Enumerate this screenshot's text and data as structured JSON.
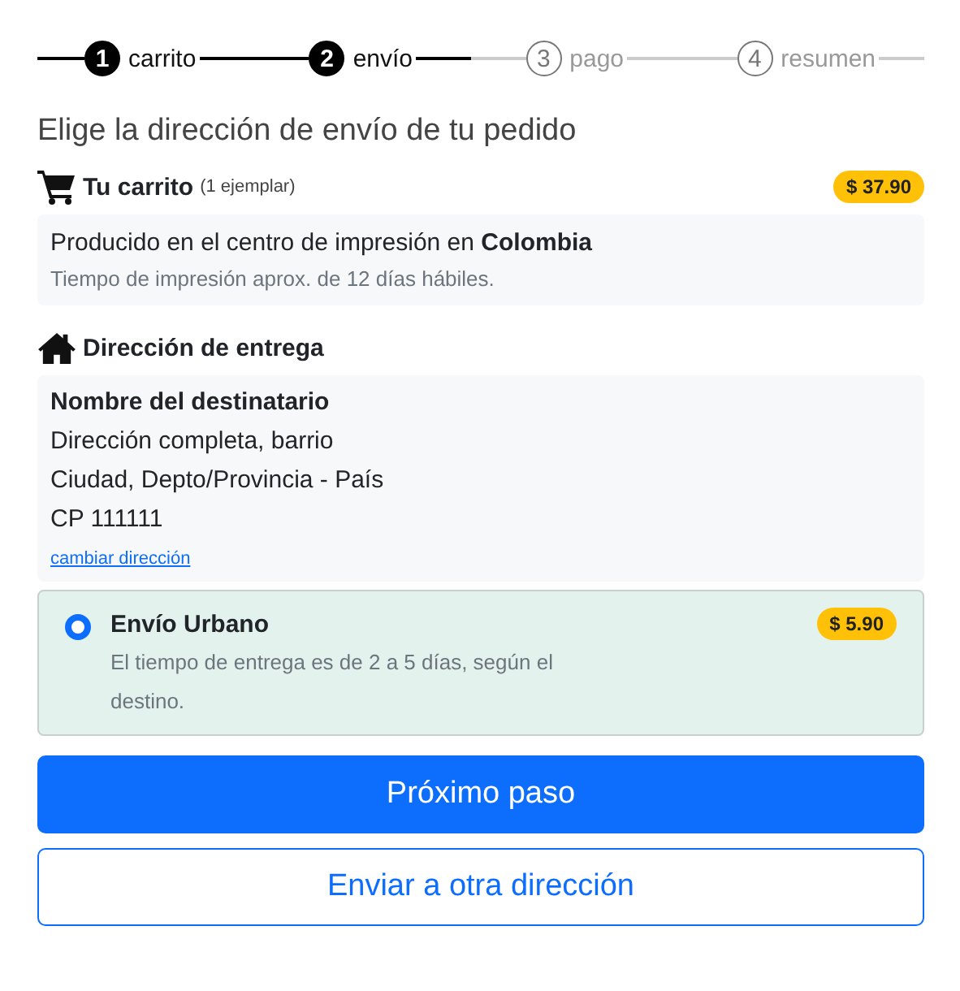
{
  "steps": [
    {
      "number": "1",
      "label": "carrito",
      "done": true
    },
    {
      "number": "2",
      "label": "envío",
      "done": true
    },
    {
      "number": "3",
      "label": "pago",
      "done": false
    },
    {
      "number": "4",
      "label": "resumen",
      "done": false
    }
  ],
  "heading": "Elige la dirección de envío de tu pedido",
  "cart": {
    "title": "Tu carrito",
    "count": "(1 ejemplar)",
    "price": "$ 37.90",
    "production": "Producido en el centro de impresión en **Colombia**",
    "print_time": "Tiempo de impresión aprox. de 12 días hábiles."
  },
  "delivery": {
    "title": "Dirección de entrega",
    "recipient": "Nombre del destinatario",
    "lines": [
      "Dirección completa, barrio",
      "Ciudad, Depto/Provincia - País",
      "CP 111111"
    ],
    "change_link": "cambiar dirección"
  },
  "shipping_options": [
    {
      "name": "Envío Urbano",
      "price": "$ 5.90",
      "description": "El tiempo de entrega es de 2 a 5 días, según el destino.",
      "selected": true
    }
  ],
  "buttons": [
    {
      "label": "Próximo paso",
      "kind": "primary"
    },
    {
      "label": "Enviar a otra dirección",
      "kind": "outline"
    }
  ]
}
